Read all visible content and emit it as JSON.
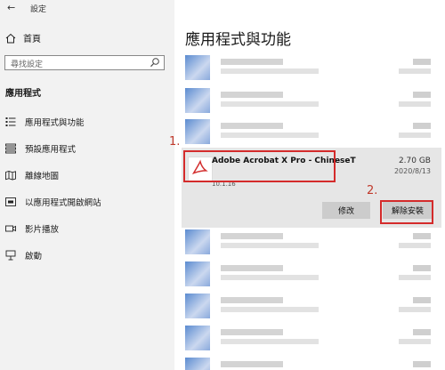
{
  "window": {
    "title": "設定",
    "back_glyph": "←"
  },
  "sidebar": {
    "home_label": "首頁",
    "search_placeholder": "尋找設定",
    "section_title": "應用程式",
    "items": [
      {
        "label": "應用程式與功能",
        "icon": "apps-list-icon"
      },
      {
        "label": "預設應用程式",
        "icon": "default-apps-icon"
      },
      {
        "label": "離線地圖",
        "icon": "map-icon"
      },
      {
        "label": "以應用程式開啟網站",
        "icon": "web-apps-icon"
      },
      {
        "label": "影片播放",
        "icon": "video-icon"
      },
      {
        "label": "啟動",
        "icon": "startup-icon"
      }
    ]
  },
  "main": {
    "title": "應用程式與功能",
    "selected_app": {
      "name": "Adobe Acrobat X Pro - ChineseT",
      "size": "2.70 GB",
      "date": "2020/8/13",
      "version": "10.1.16",
      "modify_label": "修改",
      "uninstall_label": "解除安裝"
    }
  },
  "annotations": {
    "step1": "1.",
    "step2": "2."
  },
  "colors": {
    "highlight": "#d42b2b",
    "sidebar_bg": "#f2f2f2",
    "selected_bg": "#e6e6e6"
  }
}
